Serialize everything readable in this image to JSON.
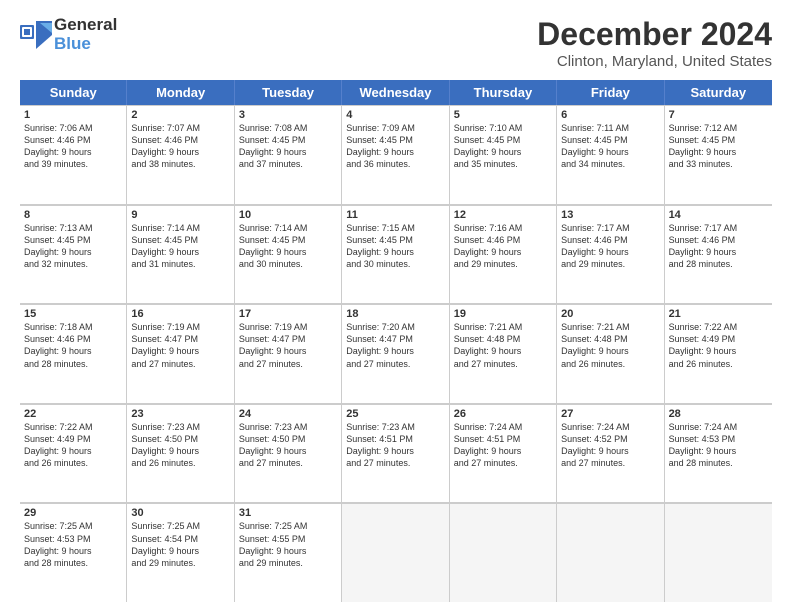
{
  "logo": {
    "line1": "General",
    "line2": "Blue"
  },
  "title": "December 2024",
  "subtitle": "Clinton, Maryland, United States",
  "header_days": [
    "Sunday",
    "Monday",
    "Tuesday",
    "Wednesday",
    "Thursday",
    "Friday",
    "Saturday"
  ],
  "weeks": [
    [
      {
        "day": "1",
        "lines": [
          "Sunrise: 7:06 AM",
          "Sunset: 4:46 PM",
          "Daylight: 9 hours",
          "and 39 minutes."
        ]
      },
      {
        "day": "2",
        "lines": [
          "Sunrise: 7:07 AM",
          "Sunset: 4:46 PM",
          "Daylight: 9 hours",
          "and 38 minutes."
        ]
      },
      {
        "day": "3",
        "lines": [
          "Sunrise: 7:08 AM",
          "Sunset: 4:45 PM",
          "Daylight: 9 hours",
          "and 37 minutes."
        ]
      },
      {
        "day": "4",
        "lines": [
          "Sunrise: 7:09 AM",
          "Sunset: 4:45 PM",
          "Daylight: 9 hours",
          "and 36 minutes."
        ]
      },
      {
        "day": "5",
        "lines": [
          "Sunrise: 7:10 AM",
          "Sunset: 4:45 PM",
          "Daylight: 9 hours",
          "and 35 minutes."
        ]
      },
      {
        "day": "6",
        "lines": [
          "Sunrise: 7:11 AM",
          "Sunset: 4:45 PM",
          "Daylight: 9 hours",
          "and 34 minutes."
        ]
      },
      {
        "day": "7",
        "lines": [
          "Sunrise: 7:12 AM",
          "Sunset: 4:45 PM",
          "Daylight: 9 hours",
          "and 33 minutes."
        ]
      }
    ],
    [
      {
        "day": "8",
        "lines": [
          "Sunrise: 7:13 AM",
          "Sunset: 4:45 PM",
          "Daylight: 9 hours",
          "and 32 minutes."
        ]
      },
      {
        "day": "9",
        "lines": [
          "Sunrise: 7:14 AM",
          "Sunset: 4:45 PM",
          "Daylight: 9 hours",
          "and 31 minutes."
        ]
      },
      {
        "day": "10",
        "lines": [
          "Sunrise: 7:14 AM",
          "Sunset: 4:45 PM",
          "Daylight: 9 hours",
          "and 30 minutes."
        ]
      },
      {
        "day": "11",
        "lines": [
          "Sunrise: 7:15 AM",
          "Sunset: 4:45 PM",
          "Daylight: 9 hours",
          "and 30 minutes."
        ]
      },
      {
        "day": "12",
        "lines": [
          "Sunrise: 7:16 AM",
          "Sunset: 4:46 PM",
          "Daylight: 9 hours",
          "and 29 minutes."
        ]
      },
      {
        "day": "13",
        "lines": [
          "Sunrise: 7:17 AM",
          "Sunset: 4:46 PM",
          "Daylight: 9 hours",
          "and 29 minutes."
        ]
      },
      {
        "day": "14",
        "lines": [
          "Sunrise: 7:17 AM",
          "Sunset: 4:46 PM",
          "Daylight: 9 hours",
          "and 28 minutes."
        ]
      }
    ],
    [
      {
        "day": "15",
        "lines": [
          "Sunrise: 7:18 AM",
          "Sunset: 4:46 PM",
          "Daylight: 9 hours",
          "and 28 minutes."
        ]
      },
      {
        "day": "16",
        "lines": [
          "Sunrise: 7:19 AM",
          "Sunset: 4:47 PM",
          "Daylight: 9 hours",
          "and 27 minutes."
        ]
      },
      {
        "day": "17",
        "lines": [
          "Sunrise: 7:19 AM",
          "Sunset: 4:47 PM",
          "Daylight: 9 hours",
          "and 27 minutes."
        ]
      },
      {
        "day": "18",
        "lines": [
          "Sunrise: 7:20 AM",
          "Sunset: 4:47 PM",
          "Daylight: 9 hours",
          "and 27 minutes."
        ]
      },
      {
        "day": "19",
        "lines": [
          "Sunrise: 7:21 AM",
          "Sunset: 4:48 PM",
          "Daylight: 9 hours",
          "and 27 minutes."
        ]
      },
      {
        "day": "20",
        "lines": [
          "Sunrise: 7:21 AM",
          "Sunset: 4:48 PM",
          "Daylight: 9 hours",
          "and 26 minutes."
        ]
      },
      {
        "day": "21",
        "lines": [
          "Sunrise: 7:22 AM",
          "Sunset: 4:49 PM",
          "Daylight: 9 hours",
          "and 26 minutes."
        ]
      }
    ],
    [
      {
        "day": "22",
        "lines": [
          "Sunrise: 7:22 AM",
          "Sunset: 4:49 PM",
          "Daylight: 9 hours",
          "and 26 minutes."
        ]
      },
      {
        "day": "23",
        "lines": [
          "Sunrise: 7:23 AM",
          "Sunset: 4:50 PM",
          "Daylight: 9 hours",
          "and 26 minutes."
        ]
      },
      {
        "day": "24",
        "lines": [
          "Sunrise: 7:23 AM",
          "Sunset: 4:50 PM",
          "Daylight: 9 hours",
          "and 27 minutes."
        ]
      },
      {
        "day": "25",
        "lines": [
          "Sunrise: 7:23 AM",
          "Sunset: 4:51 PM",
          "Daylight: 9 hours",
          "and 27 minutes."
        ]
      },
      {
        "day": "26",
        "lines": [
          "Sunrise: 7:24 AM",
          "Sunset: 4:51 PM",
          "Daylight: 9 hours",
          "and 27 minutes."
        ]
      },
      {
        "day": "27",
        "lines": [
          "Sunrise: 7:24 AM",
          "Sunset: 4:52 PM",
          "Daylight: 9 hours",
          "and 27 minutes."
        ]
      },
      {
        "day": "28",
        "lines": [
          "Sunrise: 7:24 AM",
          "Sunset: 4:53 PM",
          "Daylight: 9 hours",
          "and 28 minutes."
        ]
      }
    ],
    [
      {
        "day": "29",
        "lines": [
          "Sunrise: 7:25 AM",
          "Sunset: 4:53 PM",
          "Daylight: 9 hours",
          "and 28 minutes."
        ]
      },
      {
        "day": "30",
        "lines": [
          "Sunrise: 7:25 AM",
          "Sunset: 4:54 PM",
          "Daylight: 9 hours",
          "and 29 minutes."
        ]
      },
      {
        "day": "31",
        "lines": [
          "Sunrise: 7:25 AM",
          "Sunset: 4:55 PM",
          "Daylight: 9 hours",
          "and 29 minutes."
        ]
      },
      null,
      null,
      null,
      null
    ]
  ]
}
